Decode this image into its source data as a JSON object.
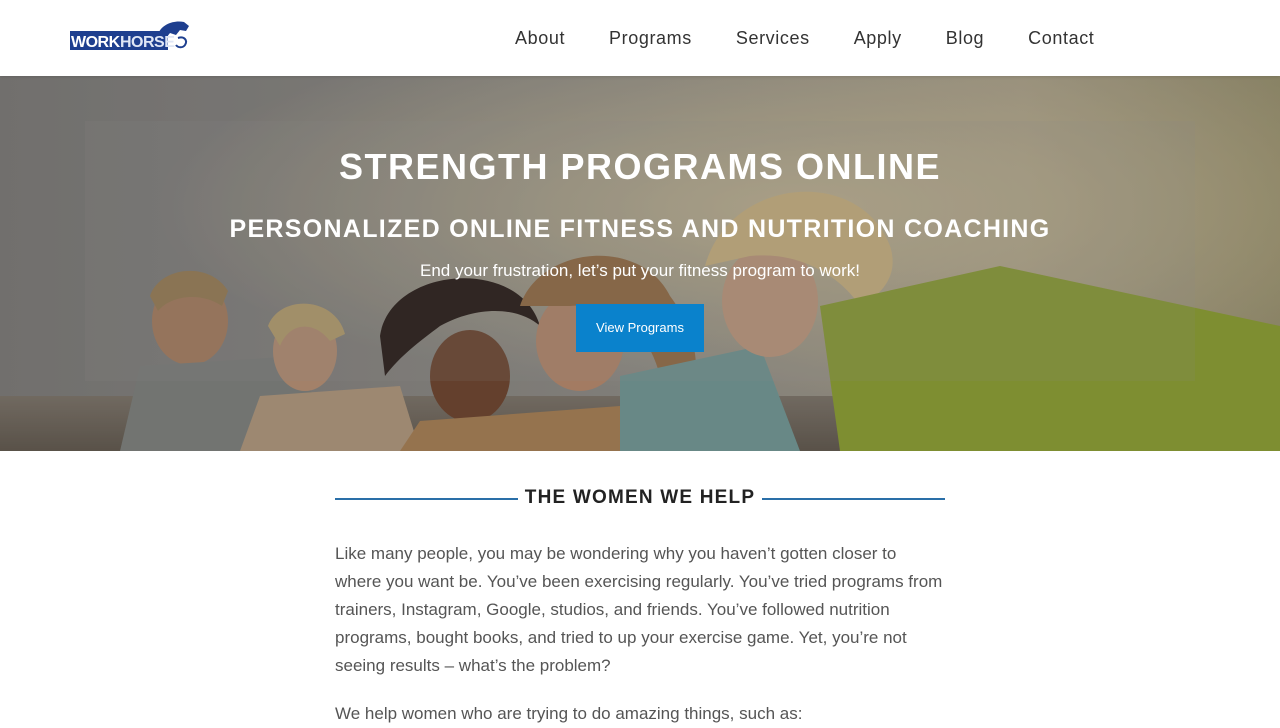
{
  "header": {
    "logo_text": "WORKHORSE",
    "nav": [
      "About",
      "Programs",
      "Services",
      "Apply",
      "Blog",
      "Contact"
    ]
  },
  "hero": {
    "title": "STRENGTH PROGRAMS ONLINE",
    "subtitle": "PERSONALIZED ONLINE FITNESS AND NUTRITION COACHING",
    "tagline": "End your frustration, let’s put your fitness program to work!",
    "button_label": "View Programs"
  },
  "section": {
    "title": "THE WOMEN WE HELP",
    "paragraph1": "Like many people, you may be wondering why you haven’t gotten closer to where you want be. You’ve been exercising regularly. You’ve tried programs from trainers, Instagram, Google, studios, and friends. You’ve followed nutrition programs, bought books, and tried to up your exercise game. Yet, you’re not seeing results – what’s the problem?",
    "paragraph2": "We help women who are trying to do amazing things, such as:"
  },
  "colors": {
    "accent": "#0a82cc",
    "rule": "#2a6fa8",
    "logo_blue": "#1e3f8f"
  },
  "icons": {
    "logo": "horse-logo-icon"
  }
}
